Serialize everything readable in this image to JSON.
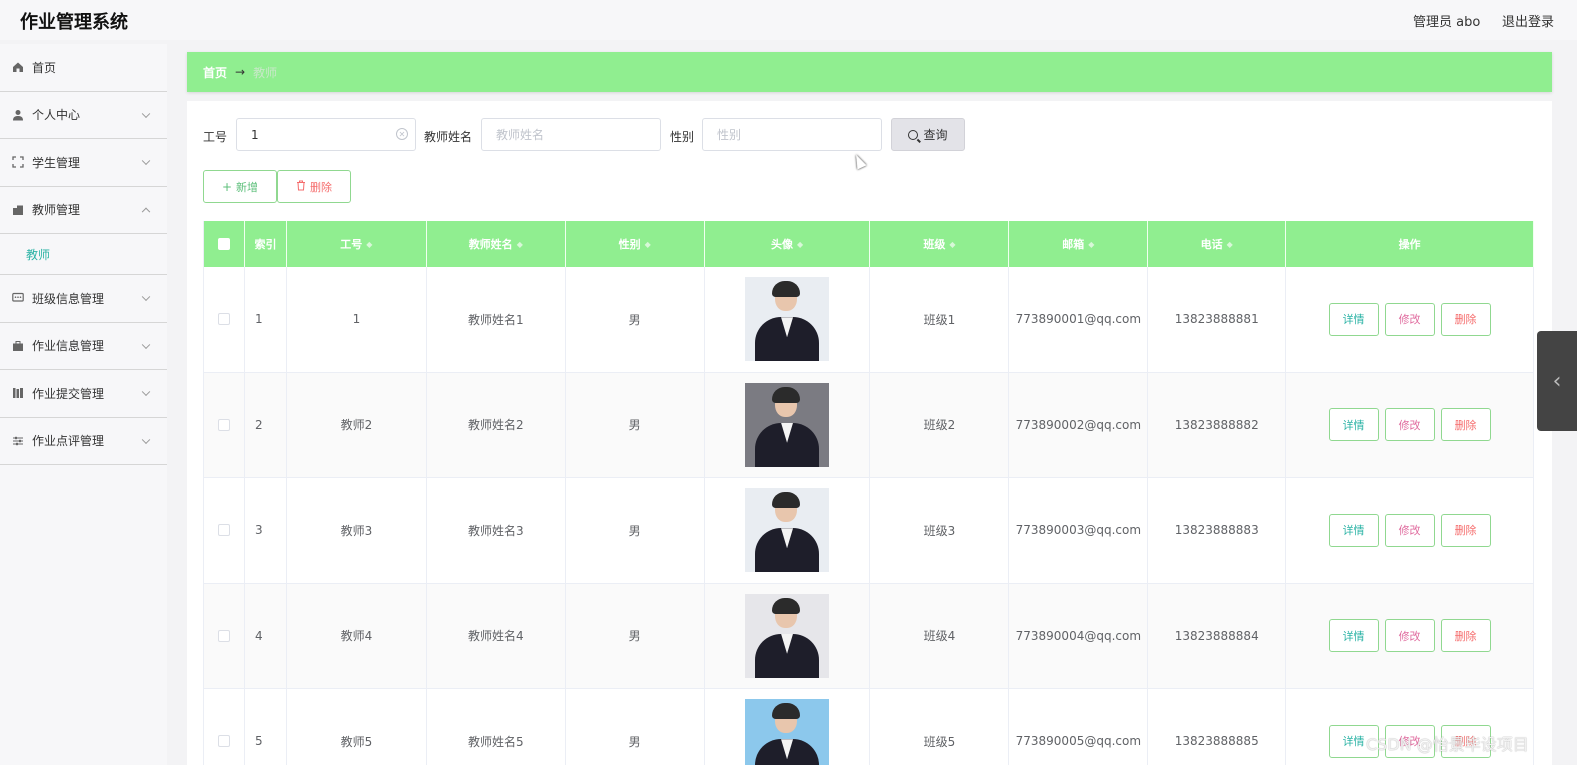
{
  "header": {
    "title": "作业管理系统",
    "admin": "管理员 abo",
    "logout": "退出登录"
  },
  "sidebar": {
    "items": [
      {
        "label": "首页",
        "icon": "home-icon"
      },
      {
        "label": "个人中心",
        "icon": "user-icon"
      },
      {
        "label": "学生管理",
        "icon": "frame-icon"
      },
      {
        "label": "教师管理",
        "icon": "folder-icon",
        "expanded": true,
        "sub": [
          "教师"
        ]
      },
      {
        "label": "班级信息管理",
        "icon": "chat-icon"
      },
      {
        "label": "作业信息管理",
        "icon": "briefcase-icon"
      },
      {
        "label": "作业提交管理",
        "icon": "book-icon"
      },
      {
        "label": "作业点评管理",
        "icon": "sliders-icon"
      }
    ]
  },
  "breadcrumb": {
    "home": "首页",
    "arrow": "→",
    "current": "教师"
  },
  "search": {
    "id_label": "工号",
    "id_value": "1",
    "name_label": "教师姓名",
    "name_placeholder": "教师姓名",
    "gender_label": "性别",
    "gender_placeholder": "性别",
    "query": "查询"
  },
  "actions": {
    "add": "新增",
    "delete": "删除"
  },
  "table": {
    "headers": [
      "索引",
      "工号",
      "教师姓名",
      "性别",
      "头像",
      "班级",
      "邮箱",
      "电话",
      "操作"
    ],
    "row_actions": {
      "detail": "详情",
      "edit": "修改",
      "delete": "删除"
    },
    "rows": [
      {
        "index": "1",
        "id": "1",
        "name": "教师姓名1",
        "gender": "男",
        "class": "班级1",
        "email": "773890001@qq.com",
        "phone": "13823888881"
      },
      {
        "index": "2",
        "id": "教师2",
        "name": "教师姓名2",
        "gender": "男",
        "class": "班级2",
        "email": "773890002@qq.com",
        "phone": "13823888882"
      },
      {
        "index": "3",
        "id": "教师3",
        "name": "教师姓名3",
        "gender": "男",
        "class": "班级3",
        "email": "773890003@qq.com",
        "phone": "13823888883"
      },
      {
        "index": "4",
        "id": "教师4",
        "name": "教师姓名4",
        "gender": "男",
        "class": "班级4",
        "email": "773890004@qq.com",
        "phone": "13823888884"
      },
      {
        "index": "5",
        "id": "教师5",
        "name": "教师姓名5",
        "gender": "男",
        "class": "班级5",
        "email": "773890005@qq.com",
        "phone": "13823888885"
      }
    ]
  },
  "watermark": "CSDN @怡景毕设项目",
  "colors": {
    "accent": "#90ee90",
    "teal": "#2bb3a5",
    "danger": "#f56c6c"
  }
}
